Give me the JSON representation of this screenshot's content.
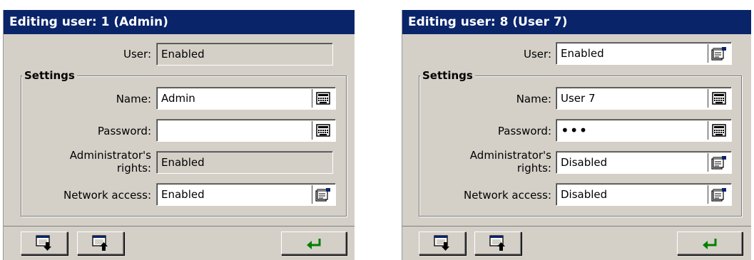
{
  "left_dialog": {
    "title": "Editing user: 1 (Admin)",
    "user_label": "User:",
    "user_value": "Enabled",
    "settings_title": "Settings",
    "name_label": "Name:",
    "name_value": "Admin",
    "password_label": "Password:",
    "password_value": "",
    "admin_label_1": "Administrator's",
    "admin_label_2": "rights:",
    "admin_value": "Enabled",
    "network_label": "Network access:",
    "network_value": "Enabled"
  },
  "right_dialog": {
    "title": "Editing user: 8 (User 7)",
    "user_label": "User:",
    "user_value": "Enabled",
    "settings_title": "Settings",
    "name_label": "Name:",
    "name_value": "User 7",
    "password_label": "Password:",
    "password_value": "•••",
    "admin_label_1": "Administrator's",
    "admin_label_2": "rights:",
    "admin_value": "Disabled",
    "network_label": "Network access:",
    "network_value": "Disabled"
  },
  "icons": {
    "keyboard": "keyboard-icon",
    "select": "select-list-icon",
    "move_down": "move-down-icon",
    "move_up": "move-up-icon",
    "enter": "enter-icon"
  },
  "colors": {
    "titlebar": "#0a246a",
    "dialog_bg": "#d4d0c8",
    "enter_arrow": "#008000"
  }
}
